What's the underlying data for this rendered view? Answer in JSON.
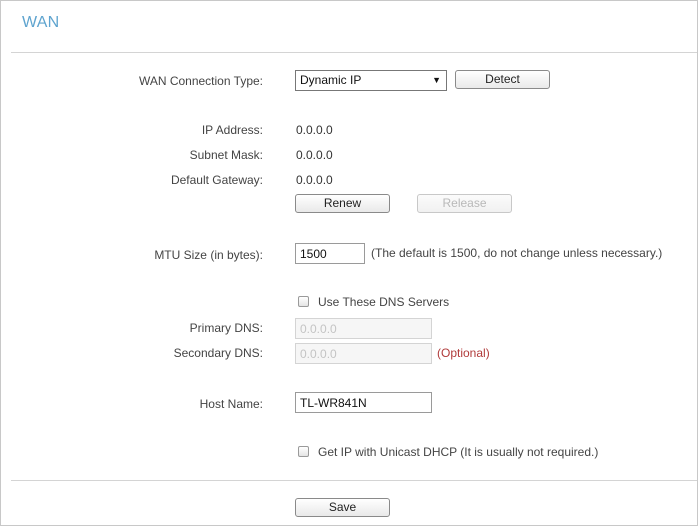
{
  "page": {
    "title": "WAN"
  },
  "connection": {
    "type_label": "WAN Connection Type:",
    "type_value": "Dynamic IP",
    "arrow_glyph": "▼",
    "detect_label": "Detect"
  },
  "status": {
    "ip_label": "IP Address:",
    "ip_value": "0.0.0.0",
    "mask_label": "Subnet Mask:",
    "mask_value": "0.0.0.0",
    "gateway_label": "Default Gateway:",
    "gateway_value": "0.0.0.0",
    "renew_label": "Renew",
    "release_label": "Release"
  },
  "mtu": {
    "label": "MTU Size (in bytes):",
    "value": "1500",
    "hint": "(The default is 1500, do not change unless necessary.)"
  },
  "dns": {
    "use_servers_label": "Use These DNS Servers",
    "use_servers_checked": false,
    "primary_label": "Primary DNS:",
    "primary_value": "0.0.0.0",
    "secondary_label": "Secondary DNS:",
    "secondary_value": "0.0.0.0",
    "optional_note": "(Optional)"
  },
  "host": {
    "label": "Host Name:",
    "value": "TL-WR841N"
  },
  "unicast": {
    "label": "Get IP with Unicast DHCP (It is usually not required.)",
    "checked": false
  },
  "footer": {
    "save_label": "Save"
  },
  "colors": {
    "title": "#5fa4cf",
    "optional_note": "#b03a3a",
    "divider": "#d4d4d4"
  }
}
